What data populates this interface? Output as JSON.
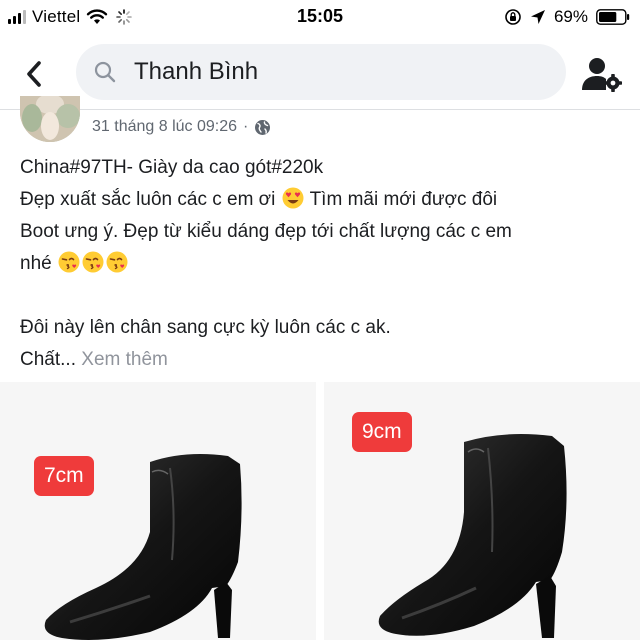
{
  "status_bar": {
    "carrier": "Viettel",
    "time": "15:05",
    "battery_percent": "69%",
    "battery_level": 0.69,
    "icons": [
      "signal-icon",
      "wifi-icon",
      "loading-spinner-icon",
      "orientation-lock-icon",
      "location-arrow-icon",
      "battery-icon"
    ]
  },
  "nav": {
    "back_icon": "chevron-left-icon",
    "search_icon": "search-icon",
    "search_value": "Thanh Bình",
    "profile_icon": "person-gear-icon"
  },
  "post": {
    "timestamp": "31 tháng 8 lúc 09:26",
    "separator": "·",
    "privacy_icon": "globe-icon",
    "lines": [
      "China#97TH- Giày da cao gót#220k",
      "Đẹp xuất sắc luôn các c em ơi",
      "Tìm mãi mới được đôi",
      "Boot ưng ý. Đẹp từ kiểu dáng đẹp tới chất lượng các c em",
      "nhé",
      "Đôi này lên chân sang cực kỳ luôn các c ak.",
      "Chất..."
    ],
    "see_more": "Xem thêm",
    "emojis": [
      "heart-eyes-emoji",
      "kissing-heart-emoji"
    ]
  },
  "photos": [
    {
      "badge": "7cm"
    },
    {
      "badge": "9cm"
    }
  ],
  "colors": {
    "badge_red": "#ef3b3b",
    "search_bg": "#f0f2f5",
    "meta_gray": "#606770",
    "see_more_gray": "#90949c"
  }
}
